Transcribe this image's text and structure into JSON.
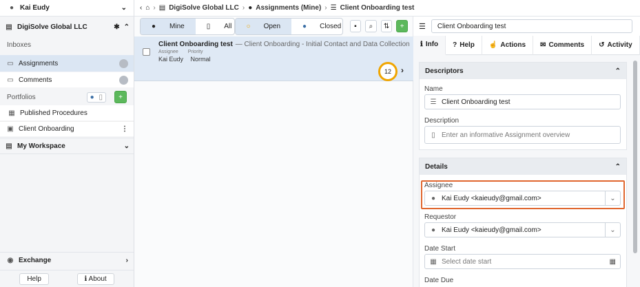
{
  "sidebar": {
    "user_name": "Kai Eudy",
    "org_name": "DigiSolve Global LLC",
    "inboxes_label": "Inboxes",
    "assignments_label": "Assignments",
    "comments_label": "Comments",
    "portfolios_label": "Portfolios",
    "published_procedures_label": "Published Procedures",
    "client_onboarding_label": "Client Onboarding",
    "my_workspace_label": "My Workspace",
    "exchange_label": "Exchange",
    "help_label": "Help",
    "about_label": "About"
  },
  "breadcrumb": {
    "org": "DigiSolve Global LLC",
    "assignments": "Assignments (Mine)",
    "current": "Client Onboarding test"
  },
  "list_toolbar": {
    "mine_label": "Mine",
    "all_label": "All",
    "open_label": "Open",
    "closed_label": "Closed"
  },
  "assignment_card": {
    "title": "Client Onboarding test",
    "subtitle": "— Client Onboarding - Initial Contact and Data Collection",
    "assignee_label": "Assignee",
    "priority_label": "Priority",
    "assignee_value": "Kai Eudy",
    "priority_value": "Normal",
    "count": "12"
  },
  "detail": {
    "name_value": "Client Onboarding test",
    "tabs": [
      "Info",
      "Help",
      "Actions",
      "Comments",
      "Activity"
    ],
    "descriptors_title": "Descriptors",
    "name_label": "Name",
    "description_label": "Description",
    "description_placeholder": "Enter an informative Assignment overview",
    "details_title": "Details",
    "assignee_label": "Assignee",
    "assignee_value": "Kai Eudy <kaieudy@gmail.com>",
    "requestor_label": "Requestor",
    "requestor_value": "Kai Eudy <kaieudy@gmail.com>",
    "date_start_label": "Date Start",
    "date_start_placeholder": "Select date start",
    "date_due_label": "Date Due"
  },
  "colors": {
    "accent": "#dbe6f3",
    "count_ring": "#f0a500",
    "highlight": "#e0662e",
    "green": "#5cb85c"
  }
}
